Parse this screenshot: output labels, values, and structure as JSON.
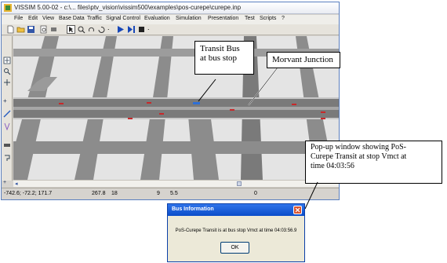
{
  "window": {
    "title": "VISSIM 5.00-02 - c:\\... files\\ptv_vision\\vissim500\\examples\\pos-curepe\\curepe.inp"
  },
  "menu": [
    "File",
    "Edit",
    "View",
    "Base Data",
    "Traffic",
    "Signal Control",
    "Evaluation",
    "Simulation",
    "Presentation",
    "Test",
    "Scripts",
    "?"
  ],
  "toolbar": {
    "icons": [
      "new-file-icon",
      "open-folder-icon",
      "save-icon",
      "print-preview-icon",
      "select-icon",
      "zoom-icon",
      "rotate-icon",
      "run-icon",
      "step-icon",
      "stop-icon"
    ],
    "trailing_dot": "."
  },
  "left_toolbar": {
    "labels": [
      "+",
      "+"
    ]
  },
  "status_bar": {
    "coords": "-742.6; -72.2; 171.7",
    "field2": "267.8",
    "field3": "18",
    "field4": "9",
    "field5": "5.5",
    "field6": "0"
  },
  "scroll": {
    "left_arrow": "◂"
  },
  "callouts": {
    "transit_bus": "Transit Bus\nat bus stop",
    "morvant": "Morvant  Junction",
    "popup": "Pop-up window showing PoS-\nCurepe Transit at stop Vmct at\ntime 04:03:56"
  },
  "dialog": {
    "title": "Bus Information",
    "message": "PoS-Curepe Transit is at bus stop Vmct at time 04:03:56.9",
    "ok_label": "OK"
  },
  "colors": {
    "road": "#7a7a7a",
    "ground": "#e4e4e4",
    "dialog_title": "#0a4cc9",
    "close_button": "#d8532f",
    "bus": "#2e6fd6",
    "vehicles": "#c8282a"
  }
}
